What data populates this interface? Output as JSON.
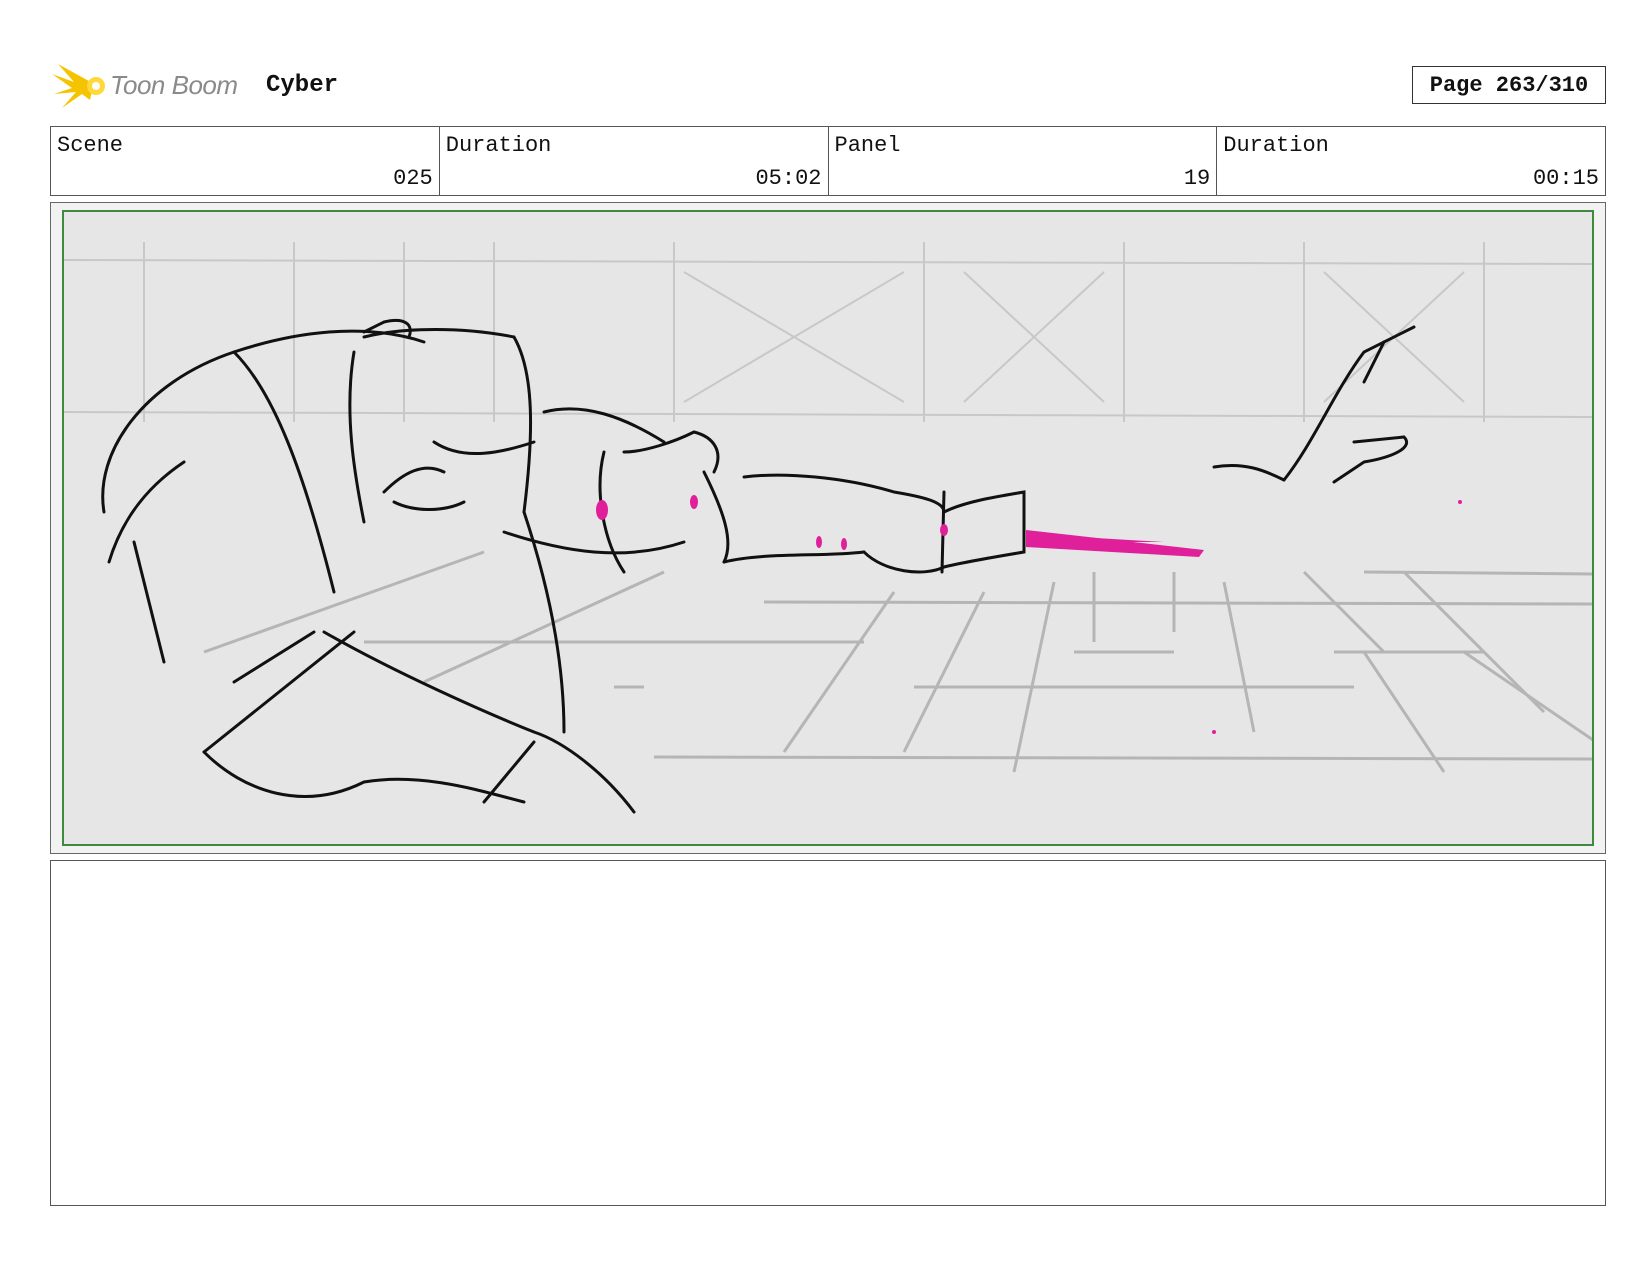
{
  "header": {
    "logo_text": "Toon Boom",
    "project_title": "Cyber",
    "page_label": "Page 263/310"
  },
  "info": {
    "scene_label": "Scene",
    "scene_value": "025",
    "scene_duration_label": "Duration",
    "scene_duration_value": "05:02",
    "panel_label": "Panel",
    "panel_value": "19",
    "panel_duration_label": "Duration",
    "panel_duration_value": "00:15"
  },
  "colors": {
    "frame_green": "#3f8a3f",
    "accent_magenta": "#e0209a",
    "logo_yellow": "#f5c400"
  },
  "notes": {
    "text": ""
  }
}
